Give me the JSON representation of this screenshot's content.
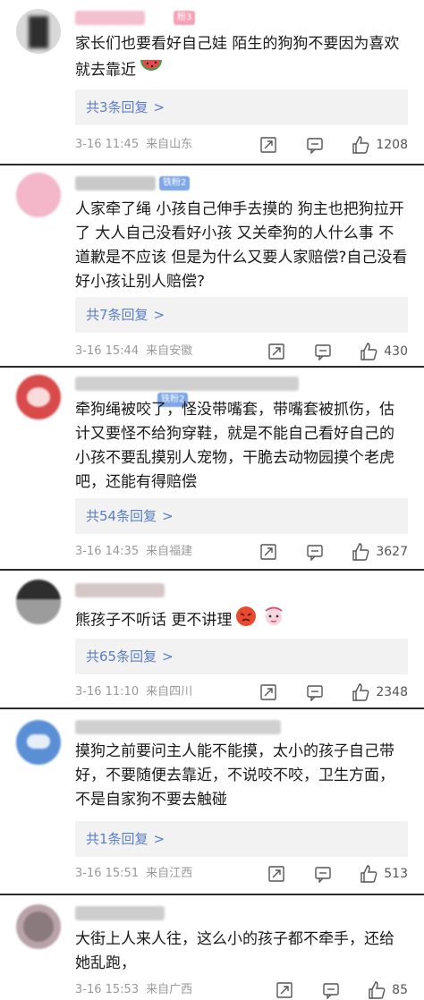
{
  "comments": [
    {
      "text": "家长们也要看好自己娃 陌生的狗狗不要因为喜欢就去靠近",
      "emoji": "watermelon",
      "replies_label": "共3条回复",
      "time": "3-16 11:45",
      "location": "来自山东",
      "likes": "1208",
      "badge": "粉3",
      "avatar_color": "#3a3a3a"
    },
    {
      "text": "人家牵了绳 小孩自己伸手去摸的 狗主也把狗拉开了 大人自己没看好小孩 又关牵狗的人什么事 不道歉是不应该 但是为什么又要人家赔偿?自己没看好小孩让别人赔偿?",
      "replies_label": "共7条回复",
      "time": "3-16 15:44",
      "location": "来自安徽",
      "likes": "430",
      "badge": "铁粉2",
      "avatar_color": "#f3b7c9"
    },
    {
      "text": "牵狗绳被咬了，怪没带嘴套，带嘴套被抓伤，估计又要怪不给狗穿鞋，就是不能自己看好自己的小孩不要乱摸别人宠物，干脆去动物园摸个老虎吧，还能有得赔偿",
      "replies_label": "共54条回复",
      "time": "3-16 14:35",
      "location": "来自福建",
      "likes": "3627",
      "badge": "铁粉2",
      "avatar_color": "#d94a4a"
    },
    {
      "text": "熊孩子不听话 更不讲理",
      "emoji": "angry-face",
      "replies_label": "共65条回复",
      "time": "3-16 11:10",
      "location": "来自四川",
      "likes": "2348",
      "avatar_color": "#2e2e2e"
    },
    {
      "text": "摸狗之前要问主人能不能摸，太小的孩子自己带好，不要随便去靠近，不说咬不咬，卫生方面，不是自家狗不要去触碰",
      "replies_label": "共1条回复",
      "time": "3-16 15:51",
      "location": "来自江西",
      "likes": "513",
      "avatar_color": "#5a8fd6"
    },
    {
      "text": "大街上人来人往，这么小的孩子都不牵手，还给她乱跑，",
      "time": "3-16 15:53",
      "location": "来自广西",
      "likes": "85",
      "avatar_color": "#b9a3a8"
    }
  ]
}
